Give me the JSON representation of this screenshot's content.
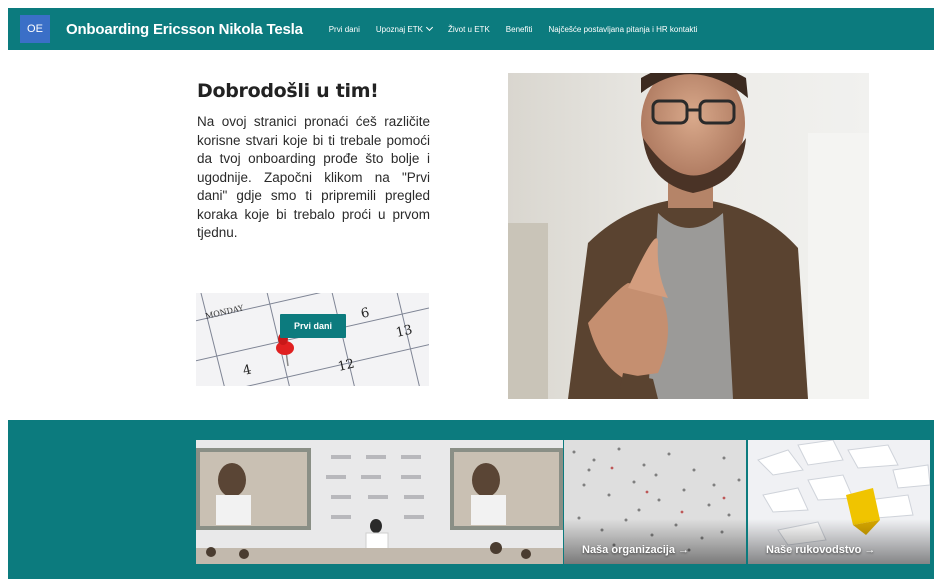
{
  "header": {
    "logo_initials": "OE",
    "site_title": "Onboarding Ericsson Nikola Tesla",
    "nav": [
      {
        "label": "Prvi dani"
      },
      {
        "label": "Upoznaj ETK"
      },
      {
        "label": "Život u ETK"
      },
      {
        "label": "Benefiti"
      },
      {
        "label": "Najčešće postavljana pitanja i HR kontakti"
      }
    ],
    "accent_color": "#0c7b7e"
  },
  "welcome": {
    "title": "Dobrodošli u tim!",
    "text": "Na ovoj stranici pronaći ćeš različite korisne stvari koje bi ti trebale pomoći da tvoj onboarding prođe što bolje i ugodnije. Započni klikom na \"Prvi dani\" gdje smo ti pripremili pregled koraka koje bi trebalo proći u prvom tjednu."
  },
  "calendar": {
    "day_label": "MONDAY",
    "numbers": [
      "6",
      "13",
      "12",
      "4"
    ],
    "button_label": "Prvi dani"
  },
  "tiles": [
    {
      "label": ""
    },
    {
      "label": "Naša organizacija →"
    },
    {
      "label": "Naše rukovodstvo →"
    }
  ]
}
